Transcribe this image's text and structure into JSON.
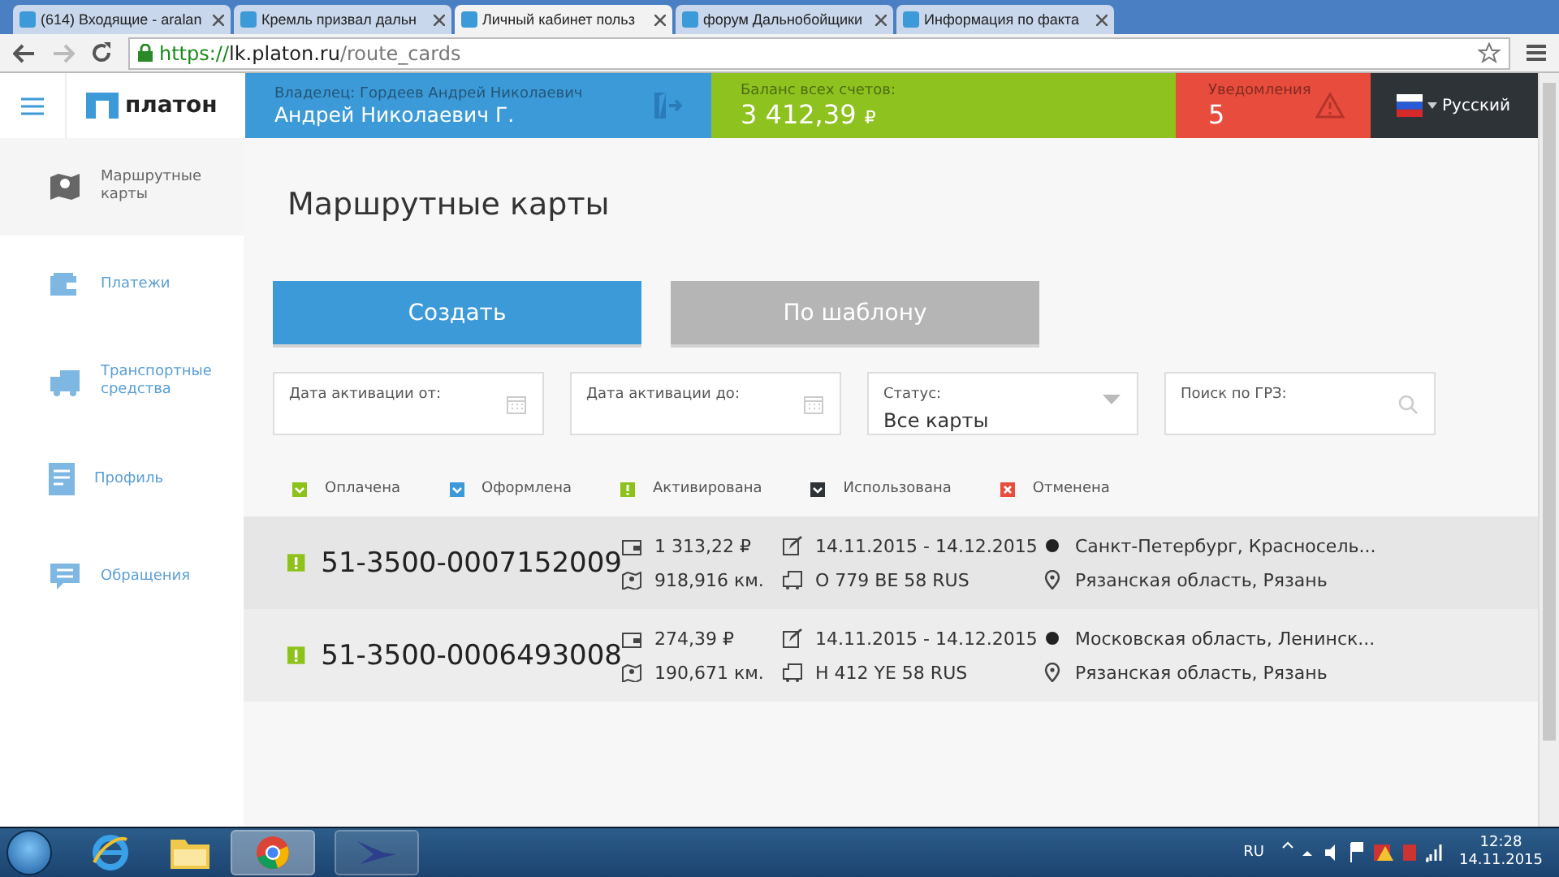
{
  "browser": {
    "tabs": [
      {
        "title": "(614) Входящие - aralan",
        "selected": false
      },
      {
        "title": "Кремль призвал дальн",
        "selected": false
      },
      {
        "title": "Личный кабинет польз",
        "selected": true
      },
      {
        "title": "форум Дальнобойщики",
        "selected": false
      },
      {
        "title": "Информация по факта",
        "selected": false
      }
    ],
    "url_scheme": "https://",
    "url_host": "lk.platon.ru",
    "url_path": "/route_cards"
  },
  "header": {
    "logo": "платон",
    "owner_label": "Владелец: Гордеев Андрей Николаевич",
    "owner_name": "Андрей Николаевич Г.",
    "balance_label": "Баланс всех счетов:",
    "balance": "3 412,39",
    "currency": "₽",
    "notifications_label": "Уведомления",
    "notifications": "5",
    "language": "Русский"
  },
  "sidebar": {
    "items": [
      {
        "label": "Маршрутные карты",
        "kind": "map",
        "selected": true
      },
      {
        "label": "Платежи",
        "kind": "wallet",
        "selected": false
      },
      {
        "label": "Транспортные средства",
        "kind": "truck",
        "selected": false
      },
      {
        "label": "Профиль",
        "kind": "profile",
        "selected": false
      },
      {
        "label": "Обращения",
        "kind": "chat",
        "selected": false
      }
    ]
  },
  "page_title": "Маршрутные карты",
  "buttons": [
    {
      "label": "Создать",
      "kind": "primary"
    },
    {
      "label": "По шаблону",
      "kind": "secondary"
    }
  ],
  "filters": [
    {
      "label": "Дата активации от:",
      "kind": "date"
    },
    {
      "label": "Дата активации до:",
      "kind": "date"
    },
    {
      "label": "Статус:",
      "kind": "select",
      "value": "Все карты"
    },
    {
      "label": "Поиск по ГРЗ:",
      "kind": "search"
    }
  ],
  "legend": [
    {
      "label": "Оплачена",
      "kind": "check",
      "color": "#8cc21a"
    },
    {
      "label": "Оформлена",
      "kind": "check",
      "color": "#3d9ad8"
    },
    {
      "label": "Активирована",
      "kind": "excl",
      "color": "#8cc21a"
    },
    {
      "label": "Использована",
      "kind": "check",
      "color": "#2e3338"
    },
    {
      "label": "Отменена",
      "kind": "cross",
      "color": "#e84c3d"
    }
  ],
  "cards": [
    {
      "number": "51-3500-0007152009",
      "color": "#8cc21a",
      "cost": "1 313,22 ₽",
      "distance": "918,916 км.",
      "period": "14.11.2015 - 14.12.2015",
      "plate": "О 779 ВЕ 58 RUS",
      "from": "Санкт-Петербург, Красносель...",
      "to": "Рязанская область, Рязань"
    },
    {
      "number": "51-3500-0006493008",
      "color": "#8cc21a",
      "cost": "274,39 ₽",
      "distance": "190,671 км.",
      "period": "14.11.2015 - 14.12.2015",
      "plate": "Н 412 YE 58 RUS",
      "from": "Московская область, Ленинск...",
      "to": "Рязанская область, Рязань"
    }
  ],
  "taskbar": {
    "language": "RU",
    "time": "12:28",
    "date": "14.11.2015"
  }
}
